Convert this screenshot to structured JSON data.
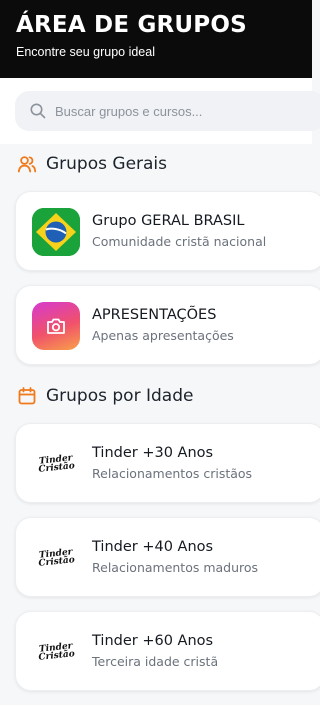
{
  "header": {
    "title": "ÁREA DE GRUPOS",
    "subtitle": "Encontre seu grupo ideal"
  },
  "search": {
    "placeholder": "Buscar grupos e cursos...",
    "icon": "search-icon"
  },
  "sections": [
    {
      "title": "Grupos Gerais",
      "icon": "users-icon",
      "items": [
        {
          "name": "Grupo GERAL BRASIL",
          "description": "Comunidade cristã nacional",
          "avatar": "brazil-flag"
        },
        {
          "name": "APRESENTAÇÕES",
          "description": "Apenas apresentações",
          "avatar": "camera-icon"
        }
      ]
    },
    {
      "title": "Grupos por Idade",
      "icon": "calendar-icon",
      "items": [
        {
          "name": "Tinder +30 Anos",
          "description": "Relacionamentos cristãos",
          "avatar": "tinder-cristao-logo"
        },
        {
          "name": "Tinder +40 Anos",
          "description": "Relacionamentos maduros",
          "avatar": "tinder-cristao-logo"
        },
        {
          "name": "Tinder +60 Anos",
          "description": "Terceira idade cristã",
          "avatar": "tinder-cristao-logo"
        }
      ]
    }
  ],
  "logo": {
    "line1": "Tinder",
    "line2": "Cristão"
  },
  "colors": {
    "header_bg": "#0b0b0b",
    "accent_orange": "#f07a1a",
    "brazil_green": "#1aa33a",
    "brazil_yellow": "#f6d21a",
    "brazil_blue": "#1f5fb5"
  }
}
